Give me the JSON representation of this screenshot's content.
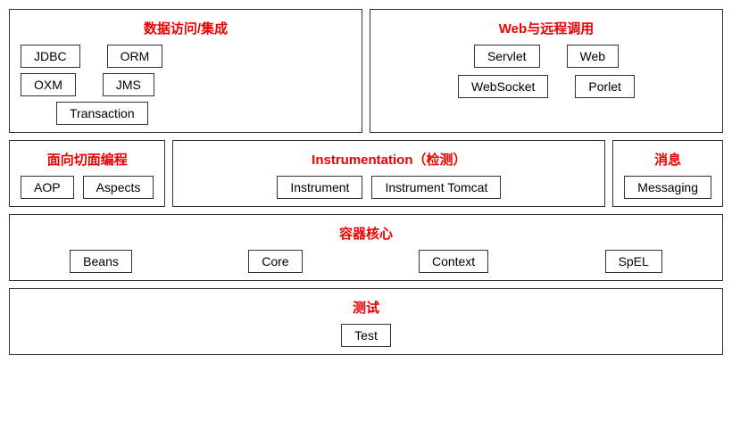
{
  "dataAccess": {
    "title": "数据访问/集成",
    "modules": [
      "JDBC",
      "ORM",
      "OXM",
      "JMS",
      "Transaction"
    ]
  },
  "webRemote": {
    "title": "Web与远程调用",
    "modules": [
      "Servlet",
      "Web",
      "WebSocket",
      "Porlet"
    ]
  },
  "aop": {
    "title": "面向切面编程",
    "modules": [
      "AOP",
      "Aspects"
    ]
  },
  "instrumentation": {
    "title": "Instrumentation（检测）",
    "modules": [
      "Instrument",
      "Instrument Tomcat"
    ]
  },
  "messaging": {
    "title": "消息",
    "modules": [
      "Messaging"
    ]
  },
  "containerCore": {
    "title": "容器核心",
    "modules": [
      "Beans",
      "Core",
      "Context",
      "SpEL"
    ]
  },
  "test": {
    "title": "测试",
    "modules": [
      "Test"
    ]
  }
}
